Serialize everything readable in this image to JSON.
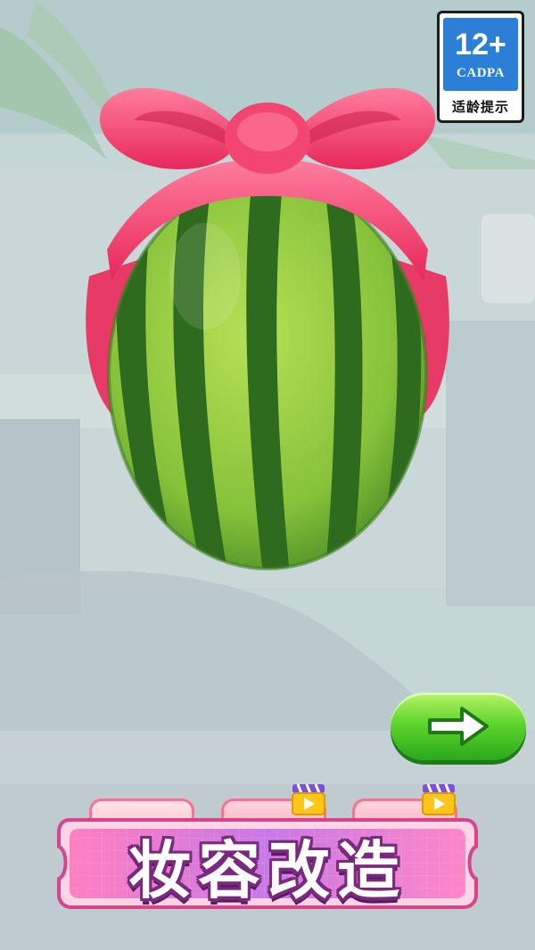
{
  "rating": {
    "age": "12+",
    "org": "CADPA",
    "hint": "适龄提示"
  },
  "footer": {
    "title": "妆容改造"
  },
  "next_button": {
    "icon": "arrow-right-icon"
  },
  "tabs": [
    {
      "id": "tab-1",
      "locked": false
    },
    {
      "id": "tab-2",
      "locked": true,
      "icon": "video-ad-icon"
    },
    {
      "id": "tab-3",
      "locked": true,
      "icon": "video-ad-icon"
    }
  ],
  "character": {
    "face": "watermelon",
    "accessory": "pink-bow-headband"
  },
  "colors": {
    "accent": "#ff4f7d",
    "button_green": "#4fcf2a",
    "banner_purple": "#b84fd0",
    "watermelon_dark": "#2f6b1e",
    "watermelon_light": "#a9d84c"
  }
}
